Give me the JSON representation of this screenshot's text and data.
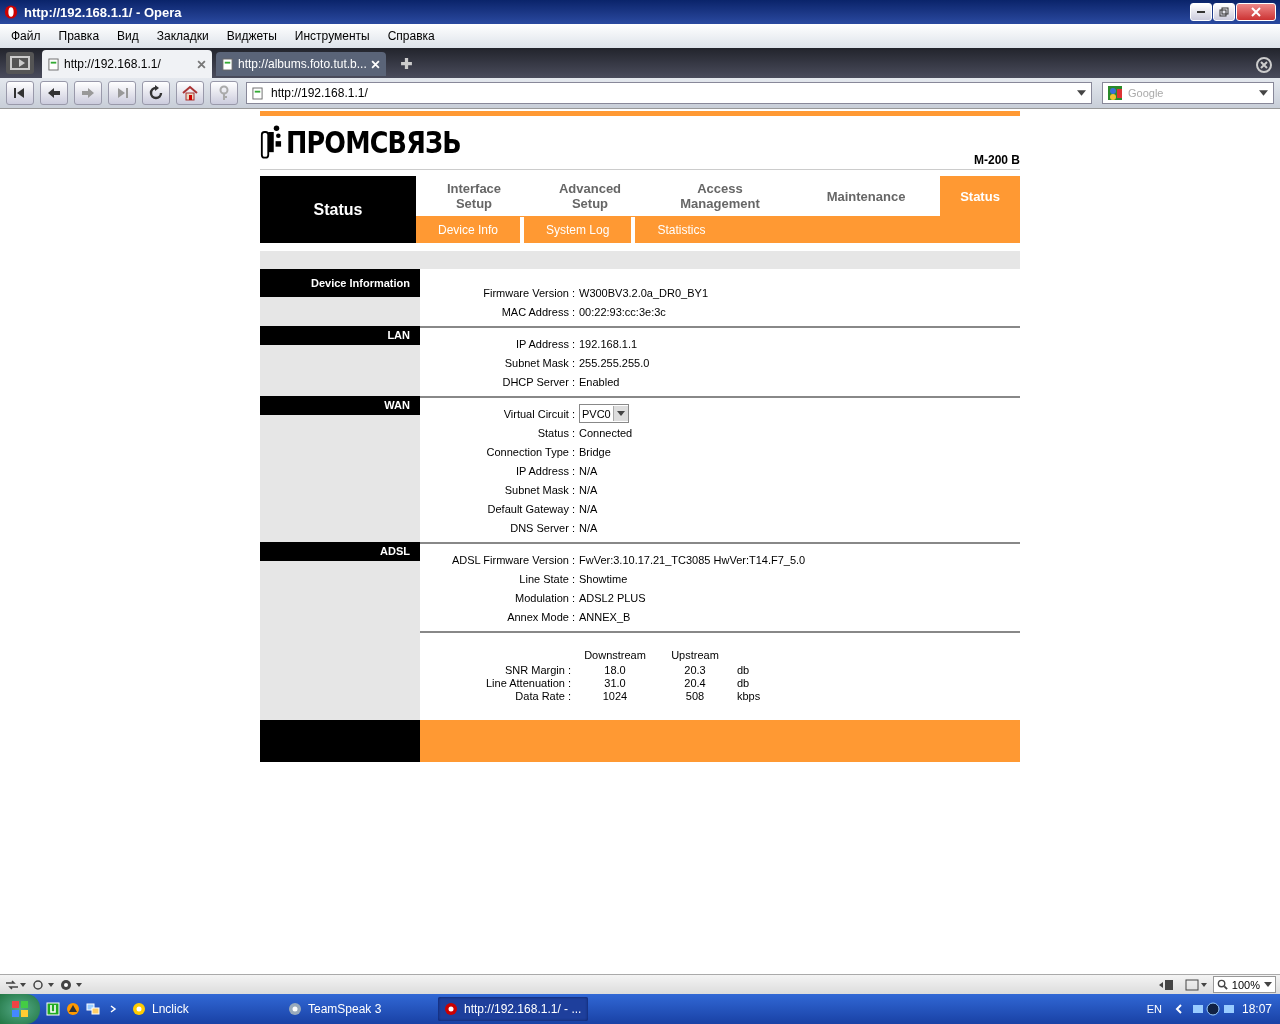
{
  "window": {
    "title": "http://192.168.1.1/ - Opera"
  },
  "menu": [
    "Файл",
    "Правка",
    "Вид",
    "Закладки",
    "Виджеты",
    "Инструменты",
    "Справка"
  ],
  "tabs": [
    {
      "title": "http://192.168.1.1/",
      "selected": true
    },
    {
      "title": "http://albums.foto.tut.b...",
      "selected": false
    }
  ],
  "address": {
    "value": "http://192.168.1.1/"
  },
  "search": {
    "placeholder": "Google"
  },
  "router": {
    "logo": "ПРОМСВЯЗЬ",
    "model": "M-200 B",
    "side_title": "Status",
    "nav": [
      {
        "label": "Interface Setup",
        "selected": false
      },
      {
        "label": "Advanced Setup",
        "selected": false
      },
      {
        "label": "Access Management",
        "selected": false
      },
      {
        "label": "Maintenance",
        "selected": false
      },
      {
        "label": "Status",
        "selected": true
      }
    ],
    "subnav": [
      "Device Info",
      "System Log",
      "Statistics"
    ],
    "sections": [
      {
        "title": "Device Information",
        "rows": [
          {
            "kind": "text",
            "label": "Firmware Version :",
            "value": "W300BV3.2.0a_DR0_BY1"
          },
          {
            "kind": "text",
            "label": "MAC Address :",
            "value": "00:22:93:cc:3e:3c"
          }
        ]
      },
      {
        "title": "LAN",
        "rows": [
          {
            "kind": "text",
            "label": "IP Address :",
            "value": "192.168.1.1"
          },
          {
            "kind": "text",
            "label": "Subnet Mask :",
            "value": "255.255.255.0"
          },
          {
            "kind": "text",
            "label": "DHCP Server :",
            "value": "Enabled"
          }
        ]
      },
      {
        "title": "WAN",
        "rows": [
          {
            "kind": "select",
            "label": "Virtual Circuit :",
            "value": "PVC0"
          },
          {
            "kind": "text",
            "label": "Status :",
            "value": "Connected"
          },
          {
            "kind": "text",
            "label": "Connection Type :",
            "value": "Bridge"
          },
          {
            "kind": "text",
            "label": "IP Address :",
            "value": "N/A"
          },
          {
            "kind": "text",
            "label": "Subnet Mask :",
            "value": "N/A"
          },
          {
            "kind": "text",
            "label": "Default Gateway :",
            "value": "N/A"
          },
          {
            "kind": "text",
            "label": "DNS Server :",
            "value": "N/A"
          }
        ]
      },
      {
        "title": "ADSL",
        "rows": [
          {
            "kind": "text",
            "label": "ADSL Firmware Version :",
            "value": "FwVer:3.10.17.21_TC3085 HwVer:T14.F7_5.0"
          },
          {
            "kind": "text",
            "label": "Line State :",
            "value": "Showtime"
          },
          {
            "kind": "text",
            "label": "Modulation :",
            "value": "ADSL2 PLUS"
          },
          {
            "kind": "text",
            "label": "Annex Mode :",
            "value": "ANNEX_B"
          }
        ]
      }
    ],
    "stats": {
      "columns": [
        "Downstream",
        "Upstream"
      ],
      "rows": [
        {
          "label": "SNR Margin :",
          "down": "18.0",
          "up": "20.3",
          "unit": "db"
        },
        {
          "label": "Line Attenuation :",
          "down": "31.0",
          "up": "20.4",
          "unit": "db"
        },
        {
          "label": "Data Rate :",
          "down": "1024",
          "up": "508",
          "unit": "kbps"
        }
      ]
    }
  },
  "status_bar": {
    "zoom": "100%"
  },
  "taskbar": {
    "items": [
      {
        "label": "Lnclick",
        "selected": false
      },
      {
        "label": "TeamSpeak 3",
        "selected": false
      },
      {
        "label": "http://192.168.1.1/ - ...",
        "selected": true
      }
    ],
    "language": "EN",
    "clock": "18:07"
  }
}
